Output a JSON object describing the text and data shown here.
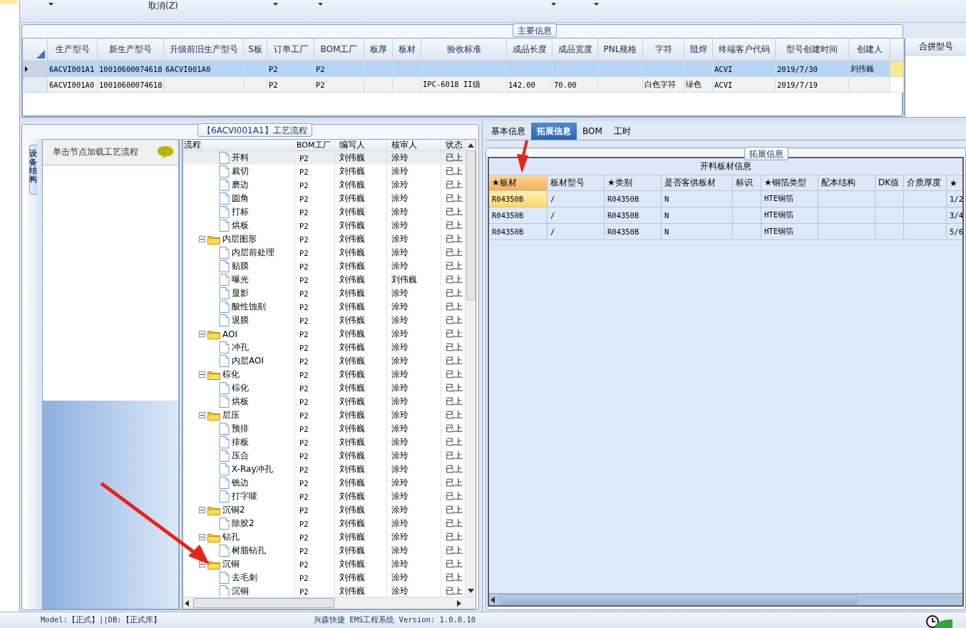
{
  "toolbar": {
    "cancel_label": "取消(Z)"
  },
  "main_info": {
    "legend": "主要信息",
    "columns": [
      "生产型号",
      "新生产型号",
      "升级前旧生产型号",
      "S板",
      "订单工厂",
      "BOM工厂",
      "板厚",
      "板材",
      "验收标准",
      "成品长度",
      "成品宽度",
      "PNL规格",
      "字符",
      "阻焊",
      "终端客户代码",
      "型号创建时间",
      "创建人"
    ],
    "rows": [
      {
        "selected": true,
        "cells": [
          "6ACVI001A1",
          "10010600074618",
          "6ACVI001A0",
          null,
          "P2",
          "P2",
          null,
          null,
          null,
          null,
          null,
          null,
          null,
          null,
          "ACVI",
          "2019/7/30",
          "刘伟巍"
        ]
      },
      {
        "selected": false,
        "cells": [
          "6ACVI001A0",
          "10010600074618",
          null,
          null,
          "P2",
          "P2",
          null,
          null,
          "IPC-6018 II级",
          "142.00",
          "70.00",
          null,
          "白色字符",
          "绿色",
          "ACVI",
          "2019/7/19",
          null
        ]
      }
    ]
  },
  "merge_panel": {
    "title": "合拼型号"
  },
  "process_panel": {
    "legend": "【6ACVI001A1】工艺流程",
    "side_tab": "设备结构",
    "hint": "单击节点加载工艺流程",
    "columns": [
      "流程",
      "BOM工厂",
      "编写人",
      "核审人",
      "状态"
    ],
    "tree": [
      {
        "children": [
          {
            "label": "开料",
            "bom": "P2",
            "writer": "刘伟巍",
            "reviewer": "涂玲",
            "status": "已上",
            "selected": true
          },
          {
            "label": "裁切",
            "bom": "P2",
            "writer": "刘伟巍",
            "reviewer": "涂玲",
            "status": "已上",
            "selected": false
          },
          {
            "label": "磨边",
            "bom": "P2",
            "writer": "刘伟巍",
            "reviewer": "涂玲",
            "status": "已上",
            "selected": false
          },
          {
            "label": "圆角",
            "bom": "P2",
            "writer": "刘伟巍",
            "reviewer": "涂玲",
            "status": "已上",
            "selected": false
          },
          {
            "label": "打标",
            "bom": "P2",
            "writer": "刘伟巍",
            "reviewer": "涂玲",
            "status": "已上",
            "selected": false
          },
          {
            "label": "烘板",
            "bom": "P2",
            "writer": "刘伟巍",
            "reviewer": "涂玲",
            "status": "已上",
            "selected": false
          }
        ]
      },
      {
        "label": "内层图形",
        "bom": "P2",
        "writer": "刘伟巍",
        "reviewer": "涂玲",
        "status": "已上",
        "selected": false,
        "expanded": true,
        "children": [
          {
            "label": "内层前处理",
            "bom": "P2",
            "writer": "刘伟巍",
            "reviewer": "涂玲",
            "status": "已上",
            "selected": false
          },
          {
            "label": "贴膜",
            "bom": "P2",
            "writer": "刘伟巍",
            "reviewer": "涂玲",
            "status": "已上",
            "selected": false
          },
          {
            "label": "曝光",
            "bom": "P2",
            "writer": "刘伟巍",
            "reviewer": "刘伟巍",
            "status": "已上",
            "selected": false
          },
          {
            "label": "显影",
            "bom": "P2",
            "writer": "刘伟巍",
            "reviewer": "涂玲",
            "status": "已上",
            "selected": false
          },
          {
            "label": "酸性蚀刻",
            "bom": "P2",
            "writer": "刘伟巍",
            "reviewer": "涂玲",
            "status": "已上",
            "selected": false
          },
          {
            "label": "退膜",
            "bom": "P2",
            "writer": "刘伟巍",
            "reviewer": "涂玲",
            "status": "已上",
            "selected": false
          }
        ]
      },
      {
        "label": "AOI",
        "bom": "P2",
        "writer": "刘伟巍",
        "reviewer": "涂玲",
        "status": "已上",
        "selected": false,
        "expanded": true,
        "children": [
          {
            "label": "冲孔",
            "bom": "P2",
            "writer": "刘伟巍",
            "reviewer": "涂玲",
            "status": "已上",
            "selected": false
          },
          {
            "label": "内层AOI",
            "bom": "P2",
            "writer": "刘伟巍",
            "reviewer": "涂玲",
            "status": "已上",
            "selected": false
          }
        ]
      },
      {
        "label": "棕化",
        "bom": "P2",
        "writer": "刘伟巍",
        "reviewer": "涂玲",
        "status": "已上",
        "selected": false,
        "expanded": true,
        "children": [
          {
            "label": "棕化",
            "bom": "P2",
            "writer": "刘伟巍",
            "reviewer": "涂玲",
            "status": "已上",
            "selected": false
          },
          {
            "label": "烘板",
            "bom": "P2",
            "writer": "刘伟巍",
            "reviewer": "涂玲",
            "status": "已上",
            "selected": false
          }
        ]
      },
      {
        "label": "层压",
        "bom": "P2",
        "writer": "刘伟巍",
        "reviewer": "涂玲",
        "status": "已上",
        "selected": false,
        "expanded": true,
        "children": [
          {
            "label": "预排",
            "bom": "P2",
            "writer": "刘伟巍",
            "reviewer": "涂玲",
            "status": "已上",
            "selected": false
          },
          {
            "label": "排板",
            "bom": "P2",
            "writer": "刘伟巍",
            "reviewer": "涂玲",
            "status": "已上",
            "selected": false
          },
          {
            "label": "压合",
            "bom": "P2",
            "writer": "刘伟巍",
            "reviewer": "涂玲",
            "status": "已上",
            "selected": false
          },
          {
            "label": "X-Ray冲孔",
            "bom": "P2",
            "writer": "刘伟巍",
            "reviewer": "涂玲",
            "status": "已上",
            "selected": false
          },
          {
            "label": "铣边",
            "bom": "P2",
            "writer": "刘伟巍",
            "reviewer": "涂玲",
            "status": "已上",
            "selected": false
          },
          {
            "label": "打字唛",
            "bom": "P2",
            "writer": "刘伟巍",
            "reviewer": "涂玲",
            "status": "已上",
            "selected": false
          }
        ]
      },
      {
        "label": "沉铜2",
        "bom": "P2",
        "writer": "刘伟巍",
        "reviewer": "涂玲",
        "status": "已上",
        "selected": false,
        "expanded": true,
        "children": [
          {
            "label": "除胶2",
            "bom": "P2",
            "writer": "刘伟巍",
            "reviewer": "涂玲",
            "status": "已上",
            "selected": false
          }
        ]
      },
      {
        "label": "钻孔",
        "bom": "P2",
        "writer": "刘伟巍",
        "reviewer": "涂玲",
        "status": "已上",
        "selected": false,
        "expanded": true,
        "children": [
          {
            "label": "树脂钻孔",
            "bom": "P2",
            "writer": "刘伟巍",
            "reviewer": "涂玲",
            "status": "已上",
            "selected": false
          }
        ]
      },
      {
        "label": "沉铜",
        "bom": "P2",
        "writer": "刘伟巍",
        "reviewer": "涂玲",
        "status": "已上",
        "selected": false,
        "expanded": true,
        "children": [
          {
            "label": "去毛刺",
            "bom": "P2",
            "writer": "刘伟巍",
            "reviewer": "涂玲",
            "status": "已上",
            "selected": false
          },
          {
            "label": "沉铜",
            "bom": "P2",
            "writer": "刘伟巍",
            "reviewer": "涂玲",
            "status": "已上",
            "selected": false
          }
        ]
      }
    ]
  },
  "detail_tabs": [
    {
      "label": "基本信息",
      "selected": false
    },
    {
      "label": "拓展信息",
      "selected": true
    },
    {
      "label": "BOM",
      "selected": false
    },
    {
      "label": "工时",
      "selected": false
    }
  ],
  "extended": {
    "legend": "拓展信息",
    "title": "开料板材信息",
    "columns": [
      "★板材",
      "板材型号",
      "★类别",
      "是否客供板材",
      "标识",
      "★铜箔类型",
      "配本结构",
      "DK值",
      "介质厚度",
      "★"
    ],
    "rows": [
      {
        "selected": true,
        "cells": [
          "R04350B",
          "/",
          "R04350B",
          "N",
          null,
          "HTE铜箔",
          null,
          null,
          null,
          "1/2"
        ]
      },
      {
        "selected": false,
        "cells": [
          "R04350B",
          "/",
          "R04350B",
          "N",
          null,
          "HTE铜箔",
          null,
          null,
          null,
          "3/4"
        ]
      },
      {
        "selected": false,
        "cells": [
          "R04350B",
          "/",
          "R04350B",
          "N",
          null,
          "HTE铜箔",
          null,
          null,
          null,
          "5/6"
        ]
      }
    ]
  },
  "status_bar": {
    "model": "Model:【正式】||DB:【正式库】",
    "app": "兴森快捷 EMS工程系统 Version: 1.0.0.10"
  }
}
